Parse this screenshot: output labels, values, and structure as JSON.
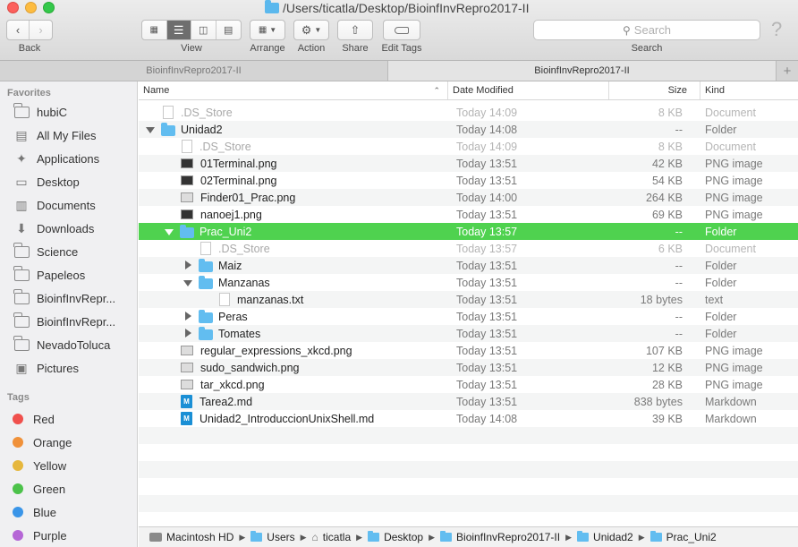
{
  "window": {
    "title": "/Users/ticatla/Desktop/BioinfInvRepro2017-II"
  },
  "toolbar": {
    "back_label": "Back",
    "view_label": "View",
    "arrange_label": "Arrange",
    "action_label": "Action",
    "share_label": "Share",
    "edit_tags_label": "Edit Tags",
    "search_label": "Search",
    "search_placeholder": "Search",
    "help_glyph": "?"
  },
  "tabs": [
    {
      "label": "BioinfInvRepro2017-II",
      "active": false
    },
    {
      "label": "BioinfInvRepro2017-II",
      "active": true
    }
  ],
  "tab_add_label": "+",
  "sidebar": {
    "favorites_header": "Favorites",
    "favorites": [
      {
        "label": "hubiC",
        "icon": "folder-icon"
      },
      {
        "label": "All My Files",
        "icon": "all-files-icon"
      },
      {
        "label": "Applications",
        "icon": "applications-icon"
      },
      {
        "label": "Desktop",
        "icon": "desktop-icon"
      },
      {
        "label": "Documents",
        "icon": "documents-icon"
      },
      {
        "label": "Downloads",
        "icon": "downloads-icon"
      },
      {
        "label": "Science",
        "icon": "folder-icon"
      },
      {
        "label": "Papeleos",
        "icon": "folder-icon"
      },
      {
        "label": "BioinfInvRepr...",
        "icon": "folder-icon"
      },
      {
        "label": "BioinfInvRepr...",
        "icon": "folder-icon"
      },
      {
        "label": "NevadoToluca",
        "icon": "folder-icon"
      },
      {
        "label": "Pictures",
        "icon": "pictures-icon"
      }
    ],
    "tags_header": "Tags",
    "tags": [
      {
        "label": "Red",
        "color": "#f0504d"
      },
      {
        "label": "Orange",
        "color": "#f0913a"
      },
      {
        "label": "Yellow",
        "color": "#e6b73d"
      },
      {
        "label": "Green",
        "color": "#4cc24a"
      },
      {
        "label": "Blue",
        "color": "#3a95e8"
      },
      {
        "label": "Purple",
        "color": "#b566d6"
      }
    ]
  },
  "columns": {
    "name": "Name",
    "date": "Date Modified",
    "size": "Size",
    "kind": "Kind"
  },
  "files": [
    {
      "name": ".DS_Store",
      "date": "Today 14:09",
      "size": "8 KB",
      "kind": "Document",
      "depth": 0,
      "disclosure": "none",
      "icon": "doc",
      "dim": true
    },
    {
      "name": "Unidad2",
      "date": "Today 14:08",
      "size": "--",
      "kind": "Folder",
      "depth": 0,
      "disclosure": "open",
      "icon": "folder"
    },
    {
      "name": ".DS_Store",
      "date": "Today 14:09",
      "size": "8 KB",
      "kind": "Document",
      "depth": 1,
      "disclosure": "none",
      "icon": "doc",
      "dim": true
    },
    {
      "name": "01Terminal.png",
      "date": "Today 13:51",
      "size": "42 KB",
      "kind": "PNG image",
      "depth": 1,
      "disclosure": "none",
      "icon": "img"
    },
    {
      "name": "02Terminal.png",
      "date": "Today 13:51",
      "size": "54 KB",
      "kind": "PNG image",
      "depth": 1,
      "disclosure": "none",
      "icon": "img"
    },
    {
      "name": "Finder01_Prac.png",
      "date": "Today 14:00",
      "size": "264 KB",
      "kind": "PNG image",
      "depth": 1,
      "disclosure": "none",
      "icon": "img-light"
    },
    {
      "name": "nanoej1.png",
      "date": "Today 13:51",
      "size": "69 KB",
      "kind": "PNG image",
      "depth": 1,
      "disclosure": "none",
      "icon": "img"
    },
    {
      "name": "Prac_Uni2",
      "date": "Today 13:57",
      "size": "--",
      "kind": "Folder",
      "depth": 1,
      "disclosure": "open",
      "icon": "folder",
      "selected": true
    },
    {
      "name": ".DS_Store",
      "date": "Today 13:57",
      "size": "6 KB",
      "kind": "Document",
      "depth": 2,
      "disclosure": "none",
      "icon": "doc",
      "dim": true
    },
    {
      "name": "Maiz",
      "date": "Today 13:51",
      "size": "--",
      "kind": "Folder",
      "depth": 2,
      "disclosure": "closed",
      "icon": "folder"
    },
    {
      "name": "Manzanas",
      "date": "Today 13:51",
      "size": "--",
      "kind": "Folder",
      "depth": 2,
      "disclosure": "open",
      "icon": "folder"
    },
    {
      "name": "manzanas.txt",
      "date": "Today 13:51",
      "size": "18 bytes",
      "kind": "text",
      "depth": 3,
      "disclosure": "none",
      "icon": "doc"
    },
    {
      "name": "Peras",
      "date": "Today 13:51",
      "size": "--",
      "kind": "Folder",
      "depth": 2,
      "disclosure": "closed",
      "icon": "folder"
    },
    {
      "name": "Tomates",
      "date": "Today 13:51",
      "size": "--",
      "kind": "Folder",
      "depth": 2,
      "disclosure": "closed",
      "icon": "folder"
    },
    {
      "name": "regular_expressions_xkcd.png",
      "date": "Today 13:51",
      "size": "107 KB",
      "kind": "PNG image",
      "depth": 1,
      "disclosure": "none",
      "icon": "img-light"
    },
    {
      "name": "sudo_sandwich.png",
      "date": "Today 13:51",
      "size": "12 KB",
      "kind": "PNG image",
      "depth": 1,
      "disclosure": "none",
      "icon": "img-light"
    },
    {
      "name": "tar_xkcd.png",
      "date": "Today 13:51",
      "size": "28 KB",
      "kind": "PNG image",
      "depth": 1,
      "disclosure": "none",
      "icon": "img-light"
    },
    {
      "name": "Tarea2.md",
      "date": "Today 13:51",
      "size": "838 bytes",
      "kind": "Markdown",
      "depth": 1,
      "disclosure": "none",
      "icon": "md"
    },
    {
      "name": "Unidad2_IntroduccionUnixShell.md",
      "date": "Today 14:08",
      "size": "39 KB",
      "kind": "Markdown",
      "depth": 1,
      "disclosure": "none",
      "icon": "md"
    }
  ],
  "md_icon_glyph": "M",
  "pathbar": [
    {
      "label": "Macintosh HD",
      "icon": "hard-drive-icon"
    },
    {
      "label": "Users",
      "icon": "folder-icon"
    },
    {
      "label": "ticatla",
      "icon": "home-icon"
    },
    {
      "label": "Desktop",
      "icon": "folder-icon"
    },
    {
      "label": "BioinfInvRepro2017-II",
      "icon": "folder-icon"
    },
    {
      "label": "Unidad2",
      "icon": "folder-icon"
    },
    {
      "label": "Prac_Uni2",
      "icon": "folder-icon"
    }
  ],
  "colors": {
    "selection": "#4fd24f",
    "folder": "#62bdf0"
  }
}
